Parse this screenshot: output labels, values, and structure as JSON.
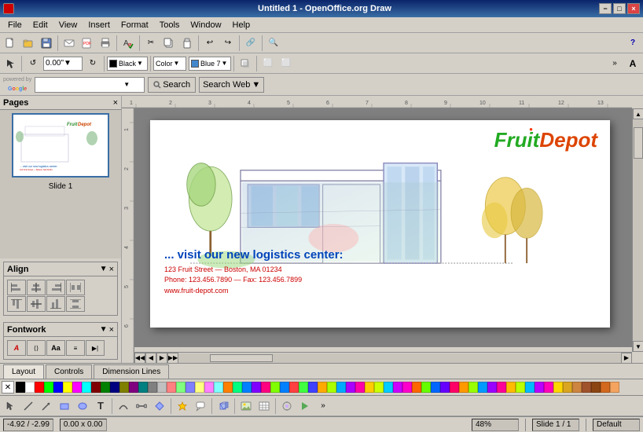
{
  "titlebar": {
    "title": "Untitled 1 - OpenOffice.org Draw",
    "minimize": "−",
    "maximize": "□",
    "close": "×"
  },
  "menubar": {
    "items": [
      "File",
      "Edit",
      "View",
      "Insert",
      "Format",
      "Tools",
      "Window",
      "Help"
    ]
  },
  "toolbar1": {
    "buttons": [
      "new",
      "open",
      "save",
      "email",
      "pdf",
      "print",
      "preview",
      "spell",
      "cut",
      "copy",
      "paste",
      "undo",
      "redo",
      "hyperlink",
      "table",
      "show_draw",
      "find",
      "help"
    ]
  },
  "toolbar2": {
    "position_label": "0.00\"",
    "color_label": "Black",
    "style_label": "Color",
    "color2_label": "Blue 7"
  },
  "google_bar": {
    "powered_by": "powered by",
    "google": "Google",
    "search_text": "",
    "search_label": "Search",
    "search_web": "Search Web",
    "dropdown_arrow": "▼"
  },
  "sidebar": {
    "pages_label": "Pages",
    "close_btn": "×",
    "slide_label": "Slide 1"
  },
  "align_panel": {
    "title": "Align",
    "close": "×",
    "expand": "▼",
    "buttons": [
      "◧",
      "◫",
      "◨",
      "□",
      "⬒",
      "⬓",
      "⬔",
      "□"
    ]
  },
  "fontwork_panel": {
    "title": "Fontwork",
    "close": "×",
    "expand": "▼",
    "buttons": [
      "A",
      "⟨",
      "Aa",
      "≡",
      "▶"
    ]
  },
  "slide": {
    "logo_fruit": "Fruit",
    "logo_depot": "Depot",
    "visit_text": "... visit our new logistics center:",
    "address_line1": "123  Fruit  Street  —  Boston, MA  01234",
    "address_line2": "Phone:  123.456.7890  —  Fax:  123.456.7899",
    "address_line3": "www.fruit-depot.com"
  },
  "tabs": {
    "items": [
      "Layout",
      "Controls",
      "Dimension Lines"
    ]
  },
  "status_bar": {
    "coordinates": "-4.92 / -2.99",
    "dimensions": "0.00 x 0.00",
    "zoom": "48%",
    "slide_info": "Slide 1 / 1",
    "style": "Default"
  },
  "colors": {
    "swatches": [
      "#000000",
      "#ffffff",
      "#ff0000",
      "#00ff00",
      "#0000ff",
      "#ffff00",
      "#ff00ff",
      "#00ffff",
      "#800000",
      "#008000",
      "#000080",
      "#808000",
      "#800080",
      "#008080",
      "#808080",
      "#c0c0c0",
      "#ff8080",
      "#80ff80",
      "#8080ff",
      "#ffff80",
      "#ff80ff",
      "#80ffff",
      "#ff8000",
      "#00ff80",
      "#0080ff",
      "#8000ff",
      "#ff0080",
      "#80ff00",
      "#0080ff",
      "#ff4040",
      "#40ff40",
      "#4040ff",
      "#ffaa00",
      "#aaff00",
      "#00aaff",
      "#aa00ff",
      "#ff00aa",
      "#ffcc00",
      "#ccff00",
      "#00ccff",
      "#cc00ff",
      "#ff00cc",
      "#ff6600",
      "#66ff00",
      "#0066ff",
      "#6600ff",
      "#ff0066",
      "#ff9900",
      "#99ff00",
      "#0099ff",
      "#9900ff",
      "#ff0099",
      "#ffbb00",
      "#bbff00",
      "#00bbff",
      "#bb00ff",
      "#ff00bb",
      "#ffd700",
      "#daa520",
      "#cd853f",
      "#a0522d",
      "#8b4513",
      "#d2691e",
      "#f4a460"
    ]
  }
}
